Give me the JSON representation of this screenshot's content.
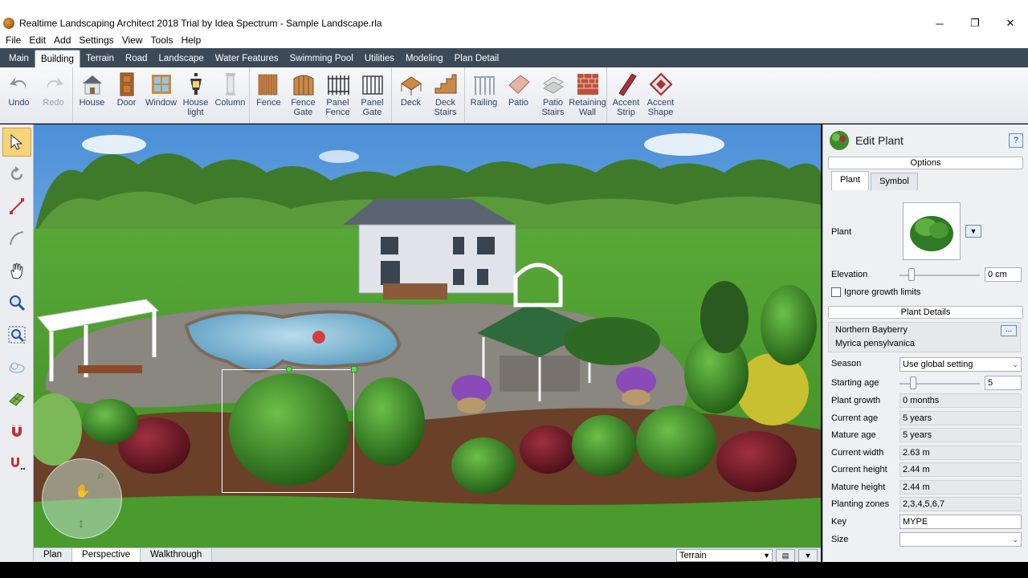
{
  "window": {
    "title": "Realtime Landscaping Architect 2018 Trial by Idea Spectrum - Sample Landscape.rla",
    "minimize": "─",
    "restore": "❐",
    "close": "✕"
  },
  "menu": [
    "File",
    "Edit",
    "Add",
    "Settings",
    "View",
    "Tools",
    "Help"
  ],
  "ribbon_tabs": [
    "Main",
    "Building",
    "Terrain",
    "Road",
    "Landscape",
    "Water Features",
    "Swimming Pool",
    "Utilities",
    "Modeling",
    "Plan Detail"
  ],
  "active_ribbon_tab": "Building",
  "toolbar": {
    "undo": "Undo",
    "redo": "Redo",
    "house": "House",
    "door": "Door",
    "window": "Window",
    "house_light": "House light",
    "column": "Column",
    "fence": "Fence",
    "fence_gate": "Fence Gate",
    "panel_fence": "Panel Fence",
    "panel_gate": "Panel Gate",
    "deck": "Deck",
    "deck_stairs": "Deck Stairs",
    "railing": "Railing",
    "patio": "Patio",
    "patio_stairs": "Patio Stairs",
    "retaining_wall": "Retaining Wall",
    "accent_strip": "Accent Strip",
    "accent_shape": "Accent Shape"
  },
  "bottom_tabs": {
    "plan": "Plan",
    "perspective": "Perspective",
    "walkthrough": "Walkthrough",
    "terrain_select": "Terrain"
  },
  "panel": {
    "title": "Edit Plant",
    "help": "?",
    "options_header": "Options",
    "tab_plant": "Plant",
    "tab_symbol": "Symbol",
    "plant_label": "Plant",
    "elevation_label": "Elevation",
    "elevation_value": "0 cm",
    "ignore_growth": "Ignore growth limits",
    "details_header": "Plant Details",
    "common_name": "Northern Bayberry",
    "latin_name": "Myrica pensylvanica",
    "more_btn": "...",
    "season_label": "Season",
    "season_value": "Use global setting",
    "starting_age_label": "Starting age",
    "starting_age_value": "5",
    "plant_growth_label": "Plant growth",
    "plant_growth_value": "0 months",
    "current_age_label": "Current age",
    "current_age_value": "5 years",
    "mature_age_label": "Mature age",
    "mature_age_value": "5 years",
    "current_width_label": "Current width",
    "current_width_value": "2.63 m",
    "current_height_label": "Current height",
    "current_height_value": "2.44 m",
    "mature_height_label": "Mature height",
    "mature_height_value": "2.44 m",
    "planting_zones_label": "Planting zones",
    "planting_zones_value": "2,3,4,5,6,7",
    "key_label": "Key",
    "key_value": "MYPE",
    "size_label": "Size",
    "size_value": ""
  }
}
